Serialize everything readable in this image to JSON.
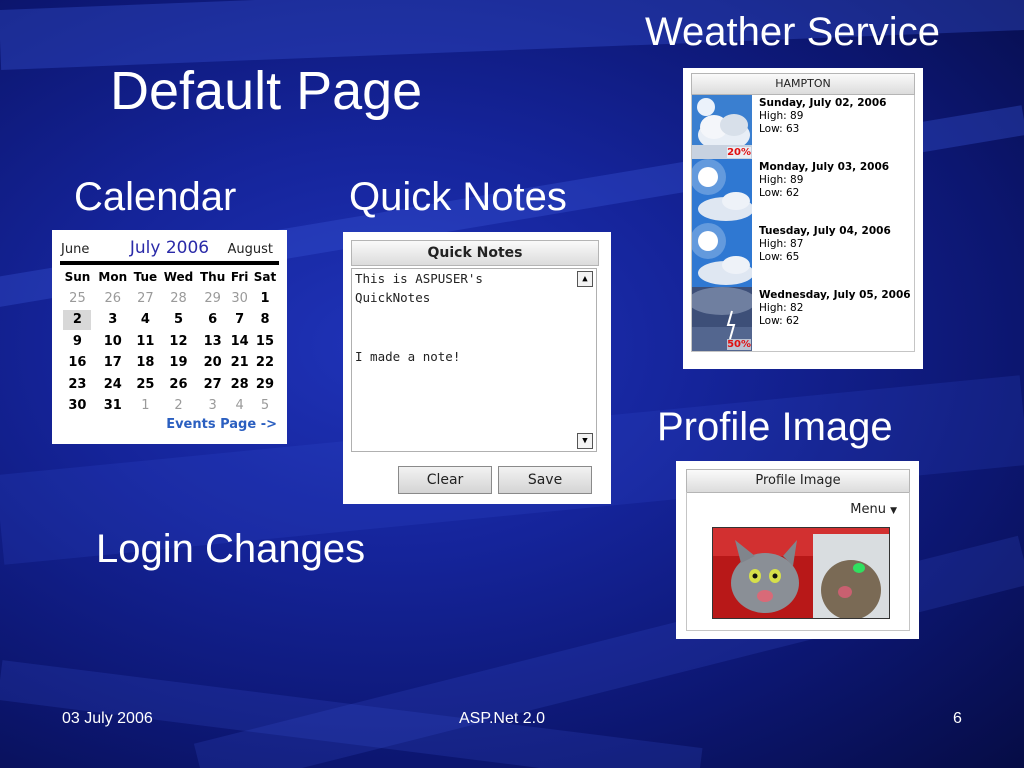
{
  "slide": {
    "title": "Default Page",
    "weather_label": "Weather Service",
    "calendar_label": "Calendar",
    "quicknotes_label": "Quick Notes",
    "profile_label": "Profile Image",
    "login_label": "Login Changes"
  },
  "calendar": {
    "prev_month": "June",
    "current_month": "July 2006",
    "next_month": "August",
    "days_of_week": [
      "Sun",
      "Mon",
      "Tue",
      "Wed",
      "Thu",
      "Fri",
      "Sat"
    ],
    "weeks": [
      [
        "25",
        "26",
        "27",
        "28",
        "29",
        "30",
        "1"
      ],
      [
        "2",
        "3",
        "4",
        "5",
        "6",
        "7",
        "8"
      ],
      [
        "9",
        "10",
        "11",
        "12",
        "13",
        "14",
        "15"
      ],
      [
        "16",
        "17",
        "18",
        "19",
        "20",
        "21",
        "22"
      ],
      [
        "23",
        "24",
        "25",
        "26",
        "27",
        "28",
        "29"
      ],
      [
        "30",
        "31",
        "1",
        "2",
        "3",
        "4",
        "5"
      ]
    ],
    "selected_day": "2",
    "events_link": "Events Page ->"
  },
  "quick_notes": {
    "title": "Quick Notes",
    "lines": [
      "This is ASPUSER's",
      "QuickNotes",
      "",
      "I made a note!"
    ],
    "clear_label": "Clear",
    "save_label": "Save"
  },
  "weather": {
    "location": "HAMPTON",
    "days": [
      {
        "date": "Sunday, July 02, 2006",
        "high": "High: 89",
        "low": "Low: 63",
        "precip": "20%",
        "icon": "partly-cloudy-rain-icon"
      },
      {
        "date": "Monday, July 03, 2006",
        "high": "High: 89",
        "low": "Low: 62",
        "precip": "",
        "icon": "partly-cloudy-icon"
      },
      {
        "date": "Tuesday, July 04, 2006",
        "high": "High: 87",
        "low": "Low: 65",
        "precip": "",
        "icon": "partly-cloudy-icon"
      },
      {
        "date": "Wednesday, July 05, 2006",
        "high": "High: 82",
        "low": "Low: 62",
        "precip": "50%",
        "icon": "thunderstorm-icon"
      }
    ]
  },
  "profile": {
    "title": "Profile Image",
    "menu_label": "Menu",
    "image": "cat-photo"
  },
  "footer": {
    "date": "03 July 2006",
    "center": "ASP.Net 2.0",
    "page": "6"
  },
  "colors": {
    "background": "#15249a",
    "calendar_month": "#2a2aa8",
    "events_link": "#2b5fc0",
    "precip": "#e01010"
  }
}
